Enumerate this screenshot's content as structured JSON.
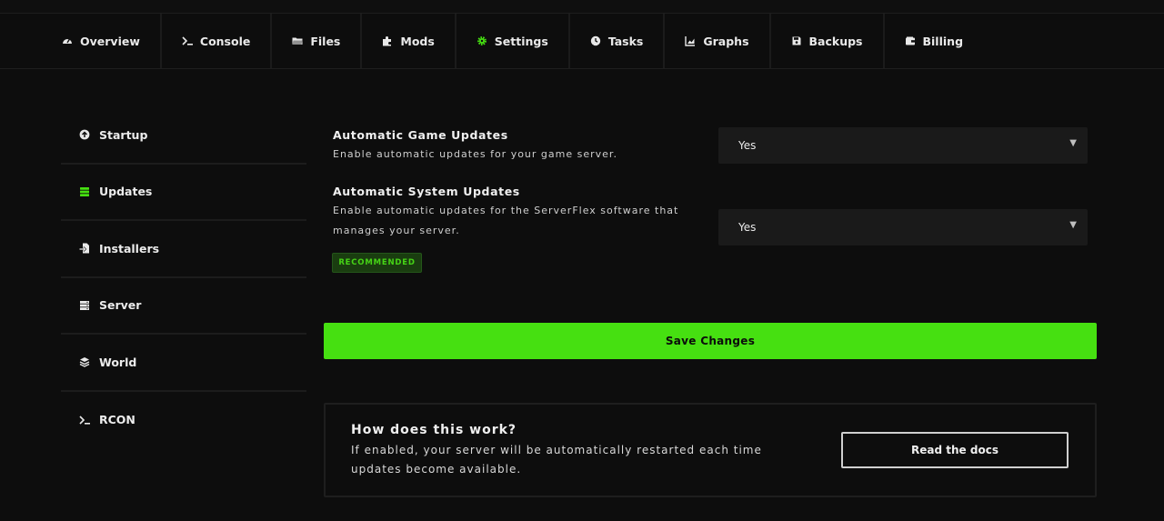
{
  "colors": {
    "accent": "#46e011",
    "badge_text": "#46d416",
    "background": "#0d0d0d"
  },
  "nav": {
    "tabs": [
      {
        "label": "Overview",
        "icon": "gauge-icon"
      },
      {
        "label": "Console",
        "icon": "terminal-icon"
      },
      {
        "label": "Files",
        "icon": "folder-icon"
      },
      {
        "label": "Mods",
        "icon": "puzzle-icon"
      },
      {
        "label": "Settings",
        "icon": "gear-icon",
        "active": true
      },
      {
        "label": "Tasks",
        "icon": "clock-icon"
      },
      {
        "label": "Graphs",
        "icon": "chart-icon"
      },
      {
        "label": "Backups",
        "icon": "save-icon"
      },
      {
        "label": "Billing",
        "icon": "wallet-icon"
      }
    ]
  },
  "sidebar": {
    "items": [
      {
        "label": "Startup",
        "icon": "arrow-up-circle-icon"
      },
      {
        "label": "Updates",
        "icon": "list-icon",
        "active": true
      },
      {
        "label": "Installers",
        "icon": "file-import-icon"
      },
      {
        "label": "Server",
        "icon": "server-icon"
      },
      {
        "label": "World",
        "icon": "layers-icon"
      },
      {
        "label": "RCON",
        "icon": "terminal-icon"
      }
    ]
  },
  "settings": {
    "game_updates": {
      "title": "Automatic Game Updates",
      "description": "Enable automatic updates for your game server.",
      "value": "Yes"
    },
    "system_updates": {
      "title": "Automatic System Updates",
      "description": "Enable automatic updates for the ServerFlex software that manages your server.",
      "value": "Yes",
      "badge": "RECOMMENDED"
    }
  },
  "save_label": "Save Changes",
  "info": {
    "title": "How does this work?",
    "description": "If enabled, your server will be automatically restarted each time updates become available.",
    "button_label": "Read the docs"
  }
}
